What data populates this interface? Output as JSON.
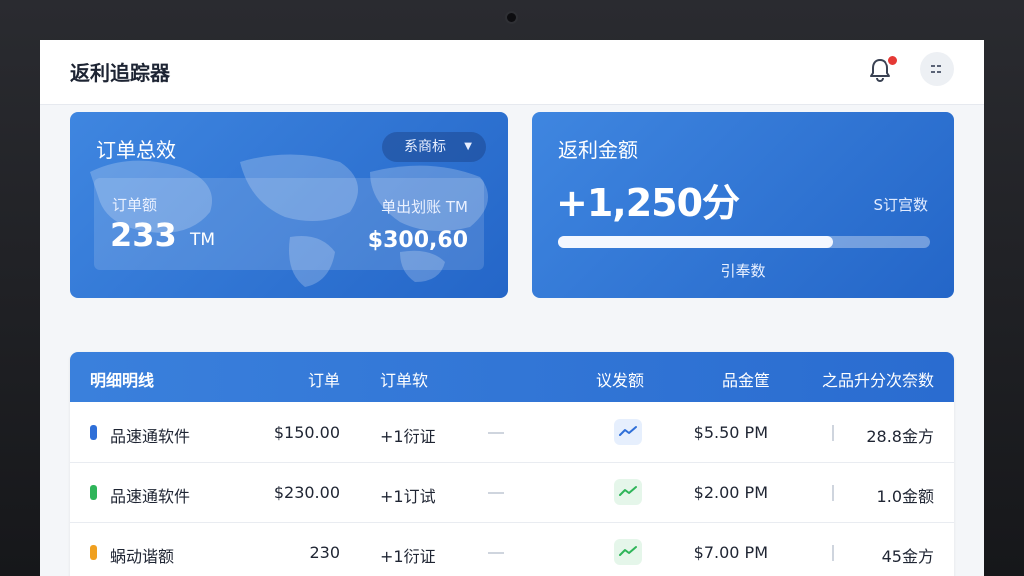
{
  "header": {
    "title": "返利追踪器"
  },
  "order_card": {
    "title": "订单总效",
    "dropdown_label": "系商标",
    "orders_label": "订单额",
    "orders_value": "233",
    "orders_unit": "TM",
    "price_label": "单出划账 TM",
    "price_value": "$300,60"
  },
  "rebate_card": {
    "title": "返利金额",
    "value": "+1,250分",
    "side_label": "S订宫数",
    "progress_fraction": 0.74,
    "progress_label": "引奉数"
  },
  "table": {
    "columns": {
      "name": "明细明线",
      "price": "订单",
      "trial": "订单软",
      "trend": "议发额",
      "time": "品金筐",
      "amount": "之品升分次奈数"
    },
    "rows": [
      {
        "color": "#2f6fd8",
        "trend_bg": "#e6effd",
        "trend_color": "#2f6fd8",
        "name": "品速通软件",
        "price": "$150.00",
        "trial": "+1衍证",
        "time": "$5.50 PM",
        "amount": "28.8金方"
      },
      {
        "color": "#2fb55a",
        "trend_bg": "#e5f6ea",
        "trend_color": "#2fb55a",
        "name": "品速通软件",
        "price": "$230.00",
        "trial": "+1订试",
        "time": "$2.00 PM",
        "amount": "1.0金额"
      },
      {
        "color": "#f0a020",
        "trend_bg": "#e5f6ea",
        "trend_color": "#2fb55a",
        "name": "蜗动谐额",
        "price": "230",
        "trial": "+1衍证",
        "time": "$7.00 PM",
        "amount": "45金方"
      }
    ]
  },
  "icons": {
    "bell": "bell-icon",
    "menu": "menu-icon",
    "dropdown": "chevron-down-icon",
    "trend": "trend-line-icon"
  }
}
